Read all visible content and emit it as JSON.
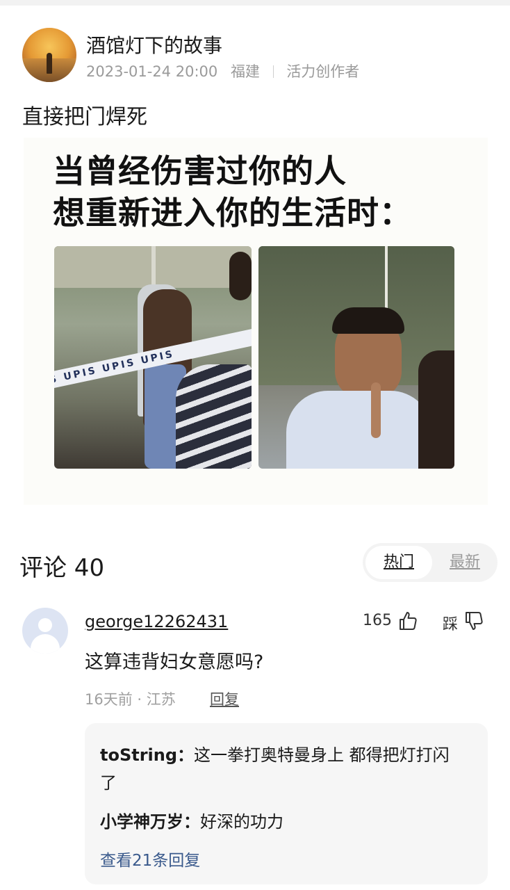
{
  "post": {
    "author": "酒馆灯下的故事",
    "date": "2023-01-24 20:00",
    "location": "福建",
    "badge": "活力创作者",
    "text": "直接把门焊死"
  },
  "meme": {
    "line1": "当曾经伤害过你的人",
    "line2": "想重新进入你的生活时："
  },
  "comments_header": {
    "title": "评论 40",
    "tab_hot": "热门",
    "tab_new": "最新"
  },
  "comment": {
    "username": "george12262431",
    "likes": "165",
    "dislike_label": "踩",
    "text": "这算违背妇女意愿吗?",
    "meta": "16天前 · 江苏",
    "reply_label": "回复",
    "replies": [
      {
        "name": "toString：",
        "text": "这一拳打奥特曼身上 都得把灯打闪了"
      },
      {
        "name": "小学神万岁：",
        "text": "好深的功力"
      }
    ],
    "view_more": "查看21条回复"
  }
}
